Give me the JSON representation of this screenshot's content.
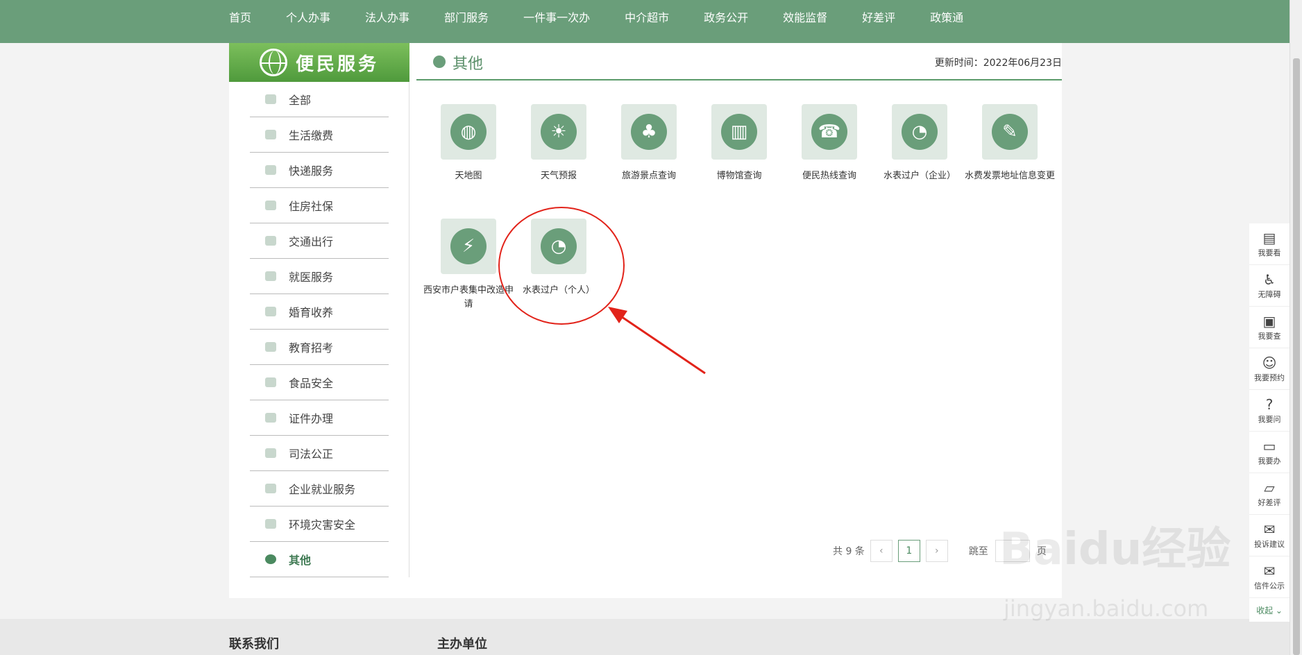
{
  "top_nav": [
    "首页",
    "个人办事",
    "法人办事",
    "部门服务",
    "一件事一次办",
    "中介超市",
    "政务公开",
    "效能监督",
    "好差评",
    "政策通"
  ],
  "sidebar": {
    "title": "便民服务",
    "items": [
      "全部",
      "生活缴费",
      "快递服务",
      "住房社保",
      "交通出行",
      "就医服务",
      "婚育收养",
      "教育招考",
      "食品安全",
      "证件办理",
      "司法公正",
      "企业就业服务",
      "环境灾害安全",
      "其他"
    ],
    "active_index": 13
  },
  "content": {
    "title": "其他",
    "update_time": "更新时间：2022年06月23日",
    "services": [
      {
        "label": "天地图",
        "icon": "globe-icon"
      },
      {
        "label": "天气预报",
        "icon": "weather-icon"
      },
      {
        "label": "旅游景点查询",
        "icon": "palm-tree-icon"
      },
      {
        "label": "博物馆查询",
        "icon": "building-icon"
      },
      {
        "label": "便民热线查询",
        "icon": "phone-icon"
      },
      {
        "label": "水表过户（企业）",
        "icon": "water-meter-icon"
      },
      {
        "label": "水费发票地址信息变更",
        "icon": "edit-icon"
      },
      {
        "label": "西安市户表集中改造申请",
        "icon": "energy-icon"
      },
      {
        "label": "水表过户（个人）",
        "icon": "water-meter-icon"
      }
    ]
  },
  "pagination": {
    "total": "共 9 条",
    "prev": "‹",
    "current": "1",
    "next": "›",
    "jump_label": "跳至",
    "page_label": "页"
  },
  "footer": {
    "contact": "联系我们",
    "host": "主办单位"
  },
  "right_toolbar": {
    "items": [
      {
        "label": "我要看",
        "icon": "view-icon"
      },
      {
        "label": "无障碍",
        "icon": "accessibility-icon"
      },
      {
        "label": "我要查",
        "icon": "search-doc-icon"
      },
      {
        "label": "我要预约",
        "icon": "user-icon"
      },
      {
        "label": "我要问",
        "icon": "question-icon"
      },
      {
        "label": "我要办",
        "icon": "briefcase-icon"
      },
      {
        "label": "好差评",
        "icon": "comment-icon"
      },
      {
        "label": "投诉建议",
        "icon": "mail-icon"
      },
      {
        "label": "信件公示",
        "icon": "letter-icon"
      }
    ],
    "collapse": "收起 ⌄"
  },
  "watermark": {
    "logo": "Baidu经验",
    "url": "jingyan.baidu.com"
  },
  "colors": {
    "theme": "#6a9e7a",
    "accent": "#4b8a60",
    "annotation": "#e2231a"
  }
}
